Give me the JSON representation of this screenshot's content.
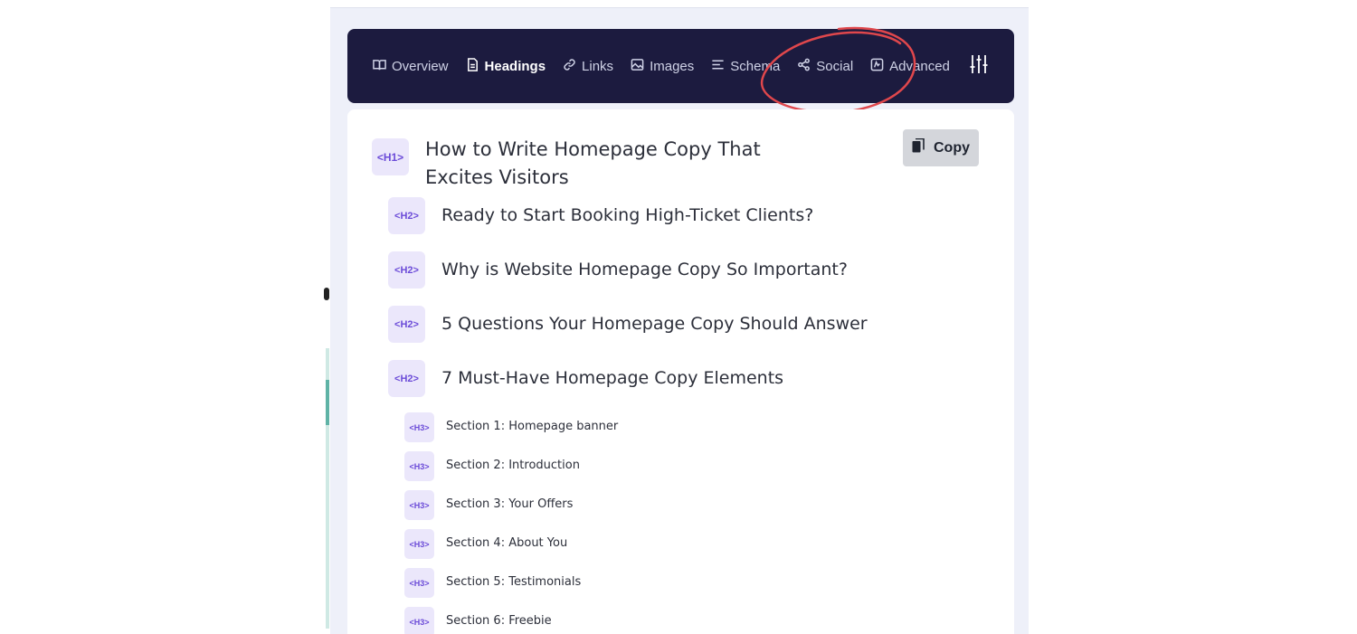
{
  "nav": {
    "tabs": [
      {
        "label": "Overview",
        "icon": "book-icon",
        "active": false
      },
      {
        "label": "Headings",
        "icon": "document-icon",
        "active": true
      },
      {
        "label": "Links",
        "icon": "link-icon",
        "active": false
      },
      {
        "label": "Images",
        "icon": "image-icon",
        "active": false
      },
      {
        "label": "Schema",
        "icon": "list-icon",
        "active": false
      },
      {
        "label": "Social",
        "icon": "share-icon",
        "active": false
      },
      {
        "label": "Advanced",
        "icon": "advanced-icon",
        "active": false
      }
    ],
    "settings_icon": "sliders-icon"
  },
  "content": {
    "copy_label": "Copy",
    "headings": [
      {
        "level": "<H1>",
        "text": "How to Write Homepage Copy That Excites Visitors"
      },
      {
        "level": "<H2>",
        "text": "Ready to Start Booking High-Ticket Clients?"
      },
      {
        "level": "<H2>",
        "text": "Why is Website Homepage Copy So Important?"
      },
      {
        "level": "<H2>",
        "text": "5 Questions Your Homepage Copy Should Answer"
      },
      {
        "level": "<H2>",
        "text": "7 Must-Have Homepage Copy Elements"
      },
      {
        "level": "<H3>",
        "text": "Section 1: Homepage banner"
      },
      {
        "level": "<H3>",
        "text": "Section 2: Introduction"
      },
      {
        "level": "<H3>",
        "text": "Section 3: Your Offers"
      },
      {
        "level": "<H3>",
        "text": "Section 4: About You"
      },
      {
        "level": "<H3>",
        "text": "Section 5: Testimonials"
      },
      {
        "level": "<H3>",
        "text": "Section 6: Freebie"
      }
    ]
  },
  "colors": {
    "navbar": "#1c1b3f",
    "tag_bg": "#ebe7fb",
    "tag_text": "#6b4bd8",
    "annotation": "#e0474c"
  }
}
